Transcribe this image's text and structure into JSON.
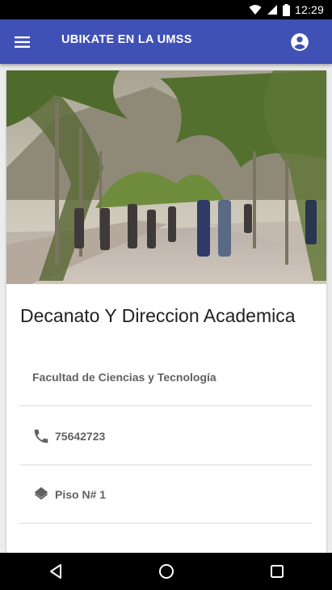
{
  "status_bar": {
    "time": "12:29"
  },
  "app_bar": {
    "title": "UBIKATE EN LA UMSS"
  },
  "card": {
    "title": "Decanato Y Direccion Academica",
    "faculty": "Facultad de Ciencias y Tecnología",
    "phone": "75642723",
    "floor": "Piso N# 1"
  },
  "colors": {
    "primary": "#3f51b5",
    "text_secondary": "#616161"
  }
}
